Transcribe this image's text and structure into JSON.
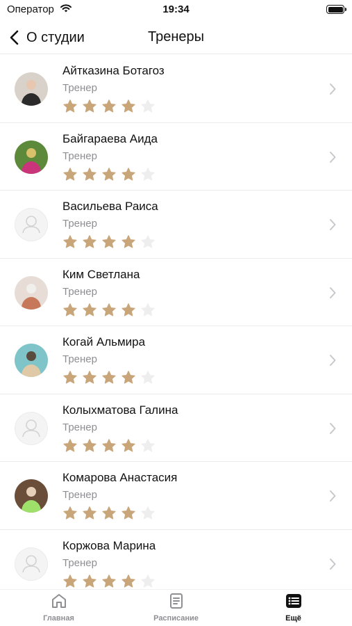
{
  "status_bar": {
    "carrier": "Оператор",
    "time": "19:34"
  },
  "nav": {
    "back_label": "О студии",
    "title": "Тренеры"
  },
  "colors": {
    "star_filled": "#c9a57a",
    "star_empty": "#eeeeee",
    "chevron": "#c7c7cc",
    "active_tab": "#111111"
  },
  "trainers": [
    {
      "name": "Айтказина Ботагоз",
      "role": "Тренер",
      "rating": 4,
      "avatar": "photo"
    },
    {
      "name": "Байгараева Аида",
      "role": "Тренер",
      "rating": 4,
      "avatar": "photo"
    },
    {
      "name": "Васильева Раиса",
      "role": "Тренер",
      "rating": 4,
      "avatar": "placeholder"
    },
    {
      "name": "Ким Светлана",
      "role": "Тренер",
      "rating": 4,
      "avatar": "photo"
    },
    {
      "name": "Когай Альмира",
      "role": "Тренер",
      "rating": 4,
      "avatar": "photo"
    },
    {
      "name": "Колыхматова Галина",
      "role": "Тренер",
      "rating": 4,
      "avatar": "placeholder"
    },
    {
      "name": "Комарова Анастасия",
      "role": "Тренер",
      "rating": 4,
      "avatar": "photo"
    },
    {
      "name": "Коржова Марина",
      "role": "Тренер",
      "rating": 4,
      "avatar": "placeholder"
    }
  ],
  "tab_bar": {
    "tabs": [
      {
        "label": "Главная",
        "icon": "home-icon",
        "active": false
      },
      {
        "label": "Расписание",
        "icon": "schedule-icon",
        "active": false
      },
      {
        "label": "Ещё",
        "icon": "more-list-icon",
        "active": true
      }
    ]
  }
}
